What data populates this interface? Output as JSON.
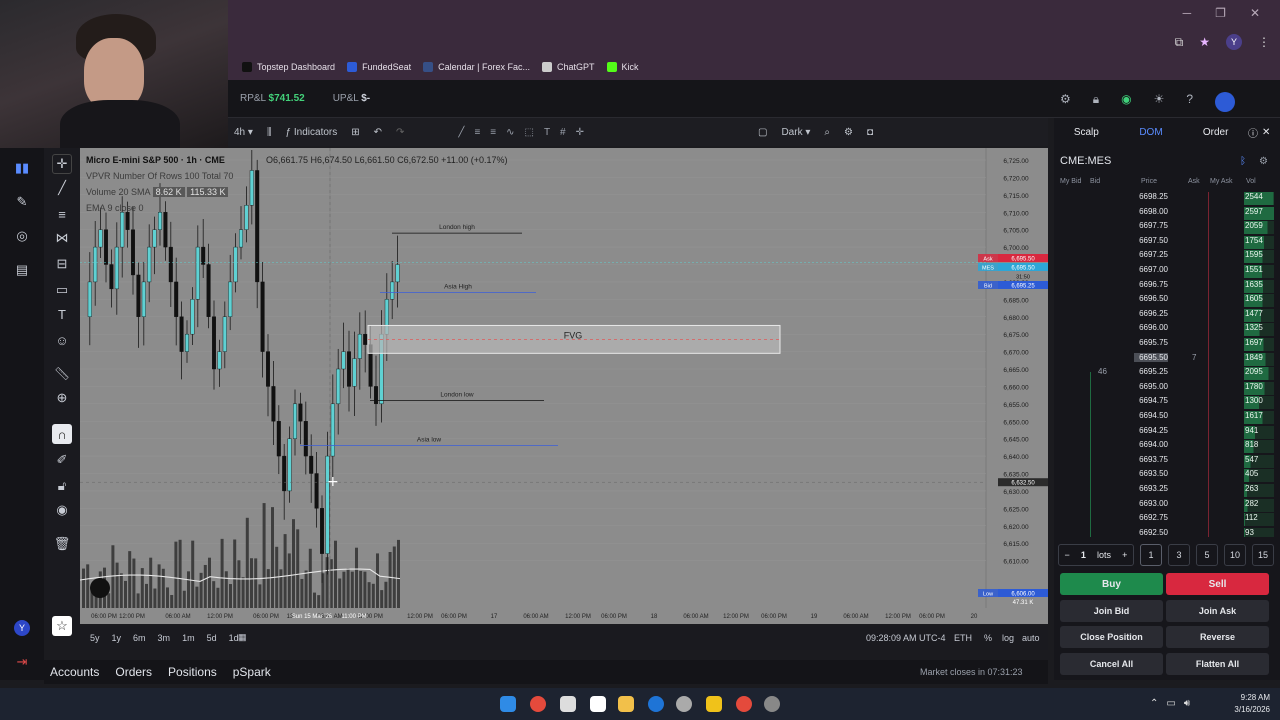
{
  "bookmarks": [
    {
      "label": "Topstep Dashboard",
      "color": "#111111"
    },
    {
      "label": "FundedSeat",
      "color": "#2d5bd6"
    },
    {
      "label": "Calendar | Forex Fac...",
      "color": "#364f86"
    },
    {
      "label": "ChatGPT",
      "color": "#cccccc"
    },
    {
      "label": "Kick",
      "color": "#53fc18"
    }
  ],
  "header": {
    "rpl_label": "RP&L",
    "rpl_value": "$741.52",
    "upl_label": "UP&L",
    "upl_value": "$-"
  },
  "toolbar": {
    "interval": "4h",
    "indicators": "Indicators",
    "theme": "Dark"
  },
  "legend": {
    "title": "Micro E-mini S&P 500 · 1h · CME",
    "ohlc": "O6,661.75 H6,674.50 L6,661.50 C6,672.50 +11.00 (+0.17%)",
    "vpvr": "VPVR Number Of Rows 100 Total 70",
    "volume_label": "Volume 20 SMA",
    "volume_v1": "8.62 K",
    "volume_v2": "115.33 K",
    "ema": "EMA 9 close 0"
  },
  "annotations": {
    "london_high": "London high",
    "asia_high": "Asia High",
    "fvg": "FVG",
    "london_low": "London low",
    "asia_low": "Asia low"
  },
  "price_axis": [
    "6,725.00",
    "6,720.00",
    "6,715.00",
    "6,710.00",
    "6,705.00",
    "6,700.00",
    "6,695.00",
    "6,690.00",
    "6,685.00",
    "6,680.00",
    "6,675.00",
    "6,670.00",
    "6,665.00",
    "6,660.00",
    "6,655.00",
    "6,650.00",
    "6,645.00",
    "6,640.00",
    "6,635.00",
    "6,630.00",
    "6,625.00",
    "6,620.00",
    "6,615.00",
    "6,610.00"
  ],
  "price_tags": {
    "ask_label": "Ask",
    "ask": "6,695.50",
    "mes_label": "MES",
    "mes": "6,695.50",
    "mes_time": "31:50",
    "bid_label": "Bid",
    "bid": "6,695.25",
    "cross": "6,632.50",
    "low_label": "Low",
    "low": "6,606.00",
    "vol": "47.31 K"
  },
  "x_axis": [
    "06:00 PM",
    "12:00 PM",
    "06:00 AM",
    "12:00 PM",
    "06:00 PM",
    "13",
    "06:00 AM",
    "12:00 PM",
    "Sun 15 Mar '26",
    "11:00 PM",
    "12:00 PM",
    "06:00 PM",
    "17",
    "06:00 AM",
    "12:00 PM",
    "06:00 PM",
    "18",
    "06:00 AM",
    "12:00 PM",
    "06:00 PM",
    "19",
    "06:00 AM",
    "12:00 PM",
    "06:00 PM",
    "20"
  ],
  "ranges": [
    "5y",
    "1y",
    "6m",
    "3m",
    "1m",
    "5d",
    "1d"
  ],
  "bottom": {
    "time": "09:28:09 AM UTC-4",
    "session": "ETH",
    "pct": "%",
    "log": "log",
    "auto": "auto",
    "market": "Market closes in 07:31:23"
  },
  "account_tabs": [
    "Accounts",
    "Orders",
    "Positions",
    "pSpark"
  ],
  "dom": {
    "tabs": [
      "Scalp",
      "DOM",
      "Order"
    ],
    "symbol": "CME:MES",
    "columns": [
      "My Bid",
      "Bid",
      "Price",
      "Ask",
      "My Ask",
      "Vol"
    ],
    "ladder": [
      {
        "price": "6698.25",
        "ask": "",
        "bid": "",
        "vol": "2544"
      },
      {
        "price": "6698.00",
        "ask": "",
        "bid": "",
        "vol": "2597"
      },
      {
        "price": "6697.75",
        "ask": "",
        "bid": "",
        "vol": "2059"
      },
      {
        "price": "6697.50",
        "ask": "",
        "bid": "",
        "vol": "1754"
      },
      {
        "price": "6697.25",
        "ask": "",
        "bid": "",
        "vol": "1595"
      },
      {
        "price": "6697.00",
        "ask": "",
        "bid": "",
        "vol": "1551"
      },
      {
        "price": "6696.75",
        "ask": "",
        "bid": "",
        "vol": "1635"
      },
      {
        "price": "6696.50",
        "ask": "",
        "bid": "",
        "vol": "1605"
      },
      {
        "price": "6696.25",
        "ask": "",
        "bid": "",
        "vol": "1477"
      },
      {
        "price": "6696.00",
        "ask": "",
        "bid": "",
        "vol": "1325"
      },
      {
        "price": "6695.75",
        "ask": "",
        "bid": "",
        "vol": "1697"
      },
      {
        "price": "6695.50",
        "ask": "7",
        "bid": "",
        "vol": "1849",
        "current": true
      },
      {
        "price": "6695.25",
        "ask": "",
        "bid": "46",
        "vol": "2095"
      },
      {
        "price": "6695.00",
        "ask": "",
        "bid": "",
        "vol": "1780"
      },
      {
        "price": "6694.75",
        "ask": "",
        "bid": "",
        "vol": "1300"
      },
      {
        "price": "6694.50",
        "ask": "",
        "bid": "",
        "vol": "1617"
      },
      {
        "price": "6694.25",
        "ask": "",
        "bid": "",
        "vol": "941"
      },
      {
        "price": "6694.00",
        "ask": "",
        "bid": "",
        "vol": "818"
      },
      {
        "price": "6693.75",
        "ask": "",
        "bid": "",
        "vol": "547"
      },
      {
        "price": "6693.50",
        "ask": "",
        "bid": "",
        "vol": "405"
      },
      {
        "price": "6693.25",
        "ask": "",
        "bid": "",
        "vol": "263"
      },
      {
        "price": "6693.00",
        "ask": "",
        "bid": "",
        "vol": "282"
      },
      {
        "price": "6692.75",
        "ask": "",
        "bid": "",
        "vol": "112"
      },
      {
        "price": "6692.50",
        "ask": "",
        "bid": "",
        "vol": "93"
      }
    ],
    "lots": "1",
    "lots_label": "lots",
    "lot_presets": [
      "1",
      "3",
      "5",
      "10",
      "15"
    ],
    "buttons": {
      "buy": "Buy",
      "sell": "Sell",
      "join_bid": "Join Bid",
      "join_ask": "Join Ask",
      "close_position": "Close Position",
      "reverse": "Reverse",
      "cancel_all": "Cancel All",
      "flatten_all": "Flatten All"
    }
  },
  "taskbar": {
    "time": "9:28 AM",
    "date": "3/16/2026"
  },
  "colors": {
    "buy": "#1e8a4c",
    "sell": "#d8283f",
    "candle_up": "#5fd1d3",
    "candle_down": "#111111",
    "accent": "#5a8cff"
  }
}
